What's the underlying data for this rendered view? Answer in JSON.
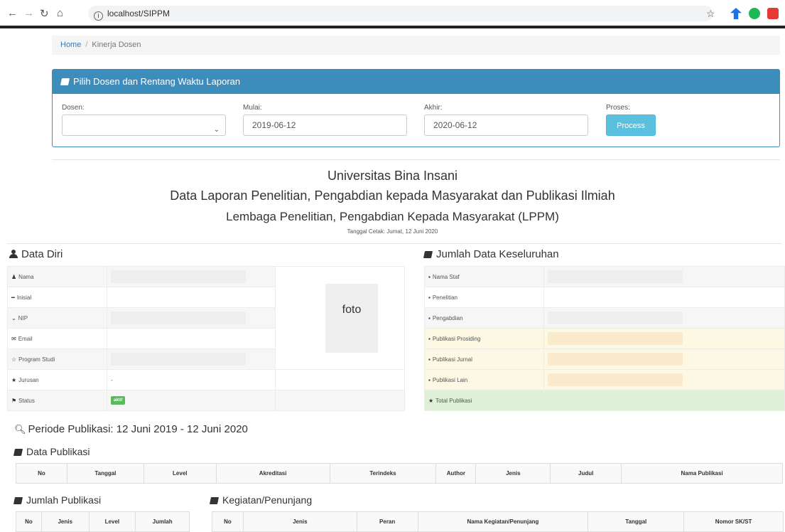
{
  "browser": {
    "url": "localhost/SIPPM"
  },
  "breadcrumb": {
    "home": "Home",
    "sep": "/",
    "current": "Kinerja Dosen"
  },
  "filter_panel": {
    "title": "Pilih Dosen dan Rentang Waktu Laporan",
    "dosen_label": "Dosen:",
    "dosen_value": "",
    "mulai_label": "Mulai:",
    "mulai_value": "2019-06-12",
    "akhir_label": "Akhir:",
    "akhir_value": "2020-06-12",
    "proses_label": "Proses:",
    "process_button": "Process"
  },
  "report_header": {
    "line1": "Universitas Bina Insani",
    "line2": "Data Laporan Penelitian, Pengabdian kepada Masyarakat dan Publikasi Ilmiah",
    "line3": "Lembaga Penelitian, Pengabdian Kepada Masyarakat (LPPM)",
    "print_date": "Tanggal Cetak: Jumat, 12 Juni 2020"
  },
  "data_diri": {
    "title": "Data Diri",
    "rows": [
      {
        "label": "Nama",
        "icon": "person-icon",
        "glyph": "♟",
        "value": ""
      },
      {
        "label": "Inisial",
        "icon": "minus-icon",
        "glyph": "━",
        "value": ""
      },
      {
        "label": "NIP",
        "icon": "chevron-icon",
        "glyph": "⌄",
        "value": ""
      },
      {
        "label": "Email",
        "icon": "envelope-icon",
        "glyph": "✉",
        "value": ""
      },
      {
        "label": "Program Studi",
        "icon": "star-empty-icon",
        "glyph": "☆",
        "value": ""
      },
      {
        "label": "Jurusan",
        "icon": "star-icon",
        "glyph": "★",
        "value": "-"
      },
      {
        "label": "Status",
        "icon": "flag-icon",
        "glyph": "⚑",
        "value": "aktif"
      }
    ],
    "foto": "foto"
  },
  "jumlah_data": {
    "title": "Jumlah Data Keseluruhan",
    "rows": [
      {
        "label": "Nama Staf",
        "icon": "book-icon"
      },
      {
        "label": "Penelitian",
        "icon": "book-icon"
      },
      {
        "label": "Pengabdian",
        "icon": "book-icon"
      },
      {
        "label": "Publikasi Prosiding",
        "icon": "book-icon"
      },
      {
        "label": "Publikasi Jurnal",
        "icon": "book-icon"
      },
      {
        "label": "Publikasi Lain",
        "icon": "book-icon"
      },
      {
        "label": "Total Publikasi",
        "icon": "star-icon"
      }
    ]
  },
  "periode": "Periode Publikasi: 12 Juni 2019 - 12 Juni 2020",
  "data_publikasi": {
    "title": "Data Publikasi",
    "columns": [
      "No",
      "Tanggal",
      "Level",
      "Akreditasi",
      "Terindeks",
      "Author",
      "Jenis",
      "Judul",
      "Nama Publikasi"
    ]
  },
  "jumlah_publikasi": {
    "title": "Jumlah Publikasi",
    "columns": [
      "No",
      "Jenis",
      "Level",
      "Jumlah"
    ]
  },
  "kegiatan": {
    "title": "Kegiatan/Penunjang",
    "columns": [
      "No",
      "Jenis",
      "Peran",
      "Nama Kegiatan/Penunjang",
      "Tanggal",
      "Nomor SK/ST"
    ]
  },
  "colors": {
    "primary": "#3c8dbc",
    "info": "#5bc0de",
    "success": "#5cb85c",
    "warning_bg": "#fcf8e3",
    "success_bg": "#dff0d8"
  }
}
